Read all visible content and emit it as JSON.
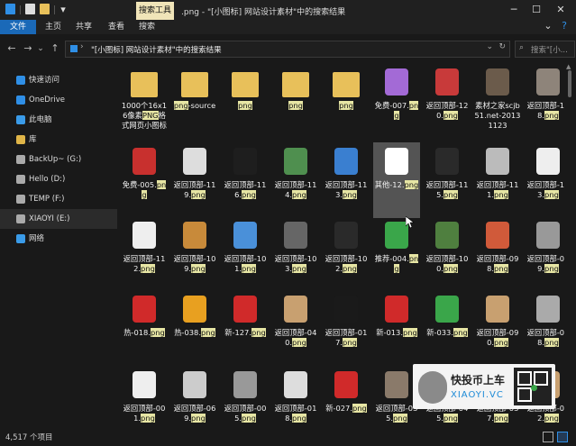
{
  "window": {
    "context_tab": "搜索工具",
    "title": ".png - \"[小图标] 网站设计素材\"中的搜索结果"
  },
  "ribbon": {
    "tabs": [
      "文件",
      "主页",
      "共享",
      "查看",
      "搜索"
    ]
  },
  "address": {
    "path": "\"[小图标] 网站设计素材\"中的搜索结果",
    "search_placeholder": "搜索\"[小..."
  },
  "sidebar": {
    "items": [
      {
        "label": "快速访问",
        "icon": "star-icon",
        "color": "#2f8fe6"
      },
      {
        "label": "OneDrive",
        "icon": "cloud-icon",
        "color": "#2f8fe6"
      },
      {
        "label": "此电脑",
        "icon": "computer-icon",
        "color": "#3a9be8"
      },
      {
        "label": "库",
        "icon": "library-icon",
        "color": "#e0b548"
      },
      {
        "label": "BackUp~ (G:)",
        "icon": "drive-icon",
        "color": "#aaaaaa"
      },
      {
        "label": "Hello (D:)",
        "icon": "drive-icon",
        "color": "#aaaaaa"
      },
      {
        "label": "TEMP (F:)",
        "icon": "drive-icon",
        "color": "#aaaaaa"
      },
      {
        "label": "XIAOYI (E:)",
        "icon": "drive-icon",
        "color": "#aaaaaa",
        "selected": true
      },
      {
        "label": "网络",
        "icon": "network-icon",
        "color": "#3a9be8"
      }
    ]
  },
  "files": [
    {
      "name": "1000个16x16像素",
      "hl": "PNG",
      "suffix": "格式网页小图标",
      "thumb": "folder-icon",
      "color": "#e8c05a"
    },
    {
      "name": "",
      "hl": "png",
      "suffix": "-source",
      "thumb": "folder-icon",
      "color": "#e8c05a"
    },
    {
      "name": "",
      "hl": "png",
      "suffix": "",
      "thumb": "folder-icon",
      "color": "#e8c05a"
    },
    {
      "name": "",
      "hl": "png",
      "suffix": "",
      "thumb": "folder-icon",
      "color": "#e8c05a"
    },
    {
      "name": "",
      "hl": "png",
      "suffix": "",
      "thumb": "folder-icon",
      "color": "#e8c05a"
    },
    {
      "name": "免费-007.",
      "hl": "pn",
      "suffix": "g",
      "thumb": "free-tag-icon",
      "color": "#a36ad6"
    },
    {
      "name": "返回顶部-120.",
      "hl": "pn",
      "suffix": "g",
      "thumb": "back-top-icon",
      "color": "#c83a3a"
    },
    {
      "name": "素材之家scjb51.net-20131123",
      "hl": "",
      "suffix": "",
      "thumb": "image-icon",
      "color": "#6b5b4b"
    },
    {
      "name": "返回顶部-118.",
      "hl": "pn",
      "suffix": "g",
      "thumb": "back-top-icon",
      "color": "#8e847a"
    },
    {
      "name": "免费-005.",
      "hl": "pn",
      "suffix": "g",
      "thumb": "free-ribbon-icon",
      "color": "#c8302e"
    },
    {
      "name": "返回顶部-119.",
      "hl": "pn",
      "suffix": "g",
      "thumb": "back-top-icon",
      "color": "#dddddd"
    },
    {
      "name": "返回顶部-116.",
      "hl": "pn",
      "suffix": "g",
      "thumb": "back-top-icon",
      "color": "#1e1e1e"
    },
    {
      "name": "返回顶部-114.",
      "hl": "pn",
      "suffix": "g",
      "thumb": "rocket-icon",
      "color": "#4f8f4f"
    },
    {
      "name": "返回顶部-113.",
      "hl": "pn",
      "suffix": "g",
      "thumb": "rocket-icon",
      "color": "#3a7fd0"
    },
    {
      "name": "其他-12.",
      "hl": "png",
      "suffix": "",
      "thumb": "eye-icon",
      "color": "#ffffff",
      "selected": true
    },
    {
      "name": "返回顶部-115.",
      "hl": "pn",
      "suffix": "g",
      "thumb": "back-top-icon",
      "color": "#2a2a2a"
    },
    {
      "name": "返回顶部-111.",
      "hl": "pn",
      "suffix": "g",
      "thumb": "back-top-icon",
      "color": "#bbbbbb"
    },
    {
      "name": "返回顶部-113.",
      "hl": "pn",
      "suffix": "g",
      "thumb": "back-top-icon",
      "color": "#eeeeee"
    },
    {
      "name": "返回顶部-112.",
      "hl": "pn",
      "suffix": "g",
      "thumb": "back-top-icon",
      "color": "#eeeeee"
    },
    {
      "name": "返回顶部-109.",
      "hl": "pn",
      "suffix": "g",
      "thumb": "monkey-icon",
      "color": "#c88a3a"
    },
    {
      "name": "返回顶部-101.",
      "hl": "pn",
      "suffix": "g",
      "thumb": "back-top-icon",
      "color": "#4a90d9"
    },
    {
      "name": "返回顶部-103.",
      "hl": "pn",
      "suffix": "g",
      "thumb": "back-top-icon",
      "color": "#666666"
    },
    {
      "name": "返回顶部-102.",
      "hl": "pn",
      "suffix": "g",
      "thumb": "back-top-icon",
      "color": "#2a2a2a"
    },
    {
      "name": "推荐-004.",
      "hl": "pn",
      "suffix": "g",
      "thumb": "recommend-tag-icon",
      "color": "#3aa64a"
    },
    {
      "name": "返回顶部-100.",
      "hl": "pn",
      "suffix": "g",
      "thumb": "back-top-icon",
      "color": "#4f7f3f"
    },
    {
      "name": "返回顶部-098.",
      "hl": "pn",
      "suffix": "g",
      "thumb": "balloon-icon",
      "color": "#d05a3a"
    },
    {
      "name": "返回顶部-099.",
      "hl": "pn",
      "suffix": "g",
      "thumb": "back-top-icon",
      "color": "#999999"
    },
    {
      "name": "热-018.",
      "hl": "pn",
      "suffix": "g",
      "thumb": "hot-tag-icon",
      "color": "#d02a2a"
    },
    {
      "name": "热-038.",
      "hl": "pn",
      "suffix": "g",
      "thumb": "hot-tag-icon",
      "color": "#e8a020"
    },
    {
      "name": "新-127.",
      "hl": "pn",
      "suffix": "g",
      "thumb": "new-tag-icon",
      "color": "#d02a2a"
    },
    {
      "name": "返回顶部-040.",
      "hl": "pn",
      "suffix": "g",
      "thumb": "back-top-icon",
      "color": "#c8a070"
    },
    {
      "name": "返回顶部-017.",
      "hl": "pn",
      "suffix": "g",
      "thumb": "back-top-icon",
      "color": "#1a1a1a"
    },
    {
      "name": "新-013.",
      "hl": "pn",
      "suffix": "g",
      "thumb": "new-tag-icon",
      "color": "#d02a2a"
    },
    {
      "name": "新-033.",
      "hl": "pn",
      "suffix": "g",
      "thumb": "new-badge-icon",
      "color": "#3aa64a"
    },
    {
      "name": "返回顶部-090.",
      "hl": "pn",
      "suffix": "g",
      "thumb": "back-top-icon",
      "color": "#c8a070"
    },
    {
      "name": "返回顶部-068.",
      "hl": "pn",
      "suffix": "g",
      "thumb": "back-top-icon",
      "color": "#aaaaaa"
    },
    {
      "name": "返回顶部-001.",
      "hl": "pn",
      "suffix": "g",
      "thumb": "back-top-icon",
      "color": "#eeeeee"
    },
    {
      "name": "返回顶部-069.",
      "hl": "pn",
      "suffix": "g",
      "thumb": "back-top-icon",
      "color": "#cccccc"
    },
    {
      "name": "返回顶部-005.",
      "hl": "pn",
      "suffix": "g",
      "thumb": "back-top-icon",
      "color": "#999999"
    },
    {
      "name": "返回顶部-018.",
      "hl": "pn",
      "suffix": "g",
      "thumb": "back-top-icon",
      "color": "#dddddd"
    },
    {
      "name": "新-027.",
      "hl": "pn",
      "suffix": "g",
      "thumb": "new-tag-icon",
      "color": "#d02a2a"
    },
    {
      "name": "返回顶部-035.",
      "hl": "pn",
      "suffix": "g",
      "thumb": "back-top-icon",
      "color": "#8a7a6a"
    },
    {
      "name": "返回顶部-045.",
      "hl": "pn",
      "suffix": "g",
      "thumb": "back-top-icon",
      "color": "#8a8a8a"
    },
    {
      "name": "返回顶部-037.",
      "hl": "pn",
      "suffix": "g",
      "thumb": "back-top-icon",
      "color": "#2a2a2a"
    },
    {
      "name": "返回顶部-082.",
      "hl": "pn",
      "suffix": "g",
      "thumb": "back-top-icon",
      "color": "#c8a070"
    }
  ],
  "status": {
    "count": "4,517 个项目"
  },
  "watermark": {
    "cn": "快投币上车",
    "en": "XIAOYI.VC"
  },
  "colors": {
    "accent": "#1a69b8",
    "highlight": "#e7e6a4",
    "background": "#191919"
  }
}
